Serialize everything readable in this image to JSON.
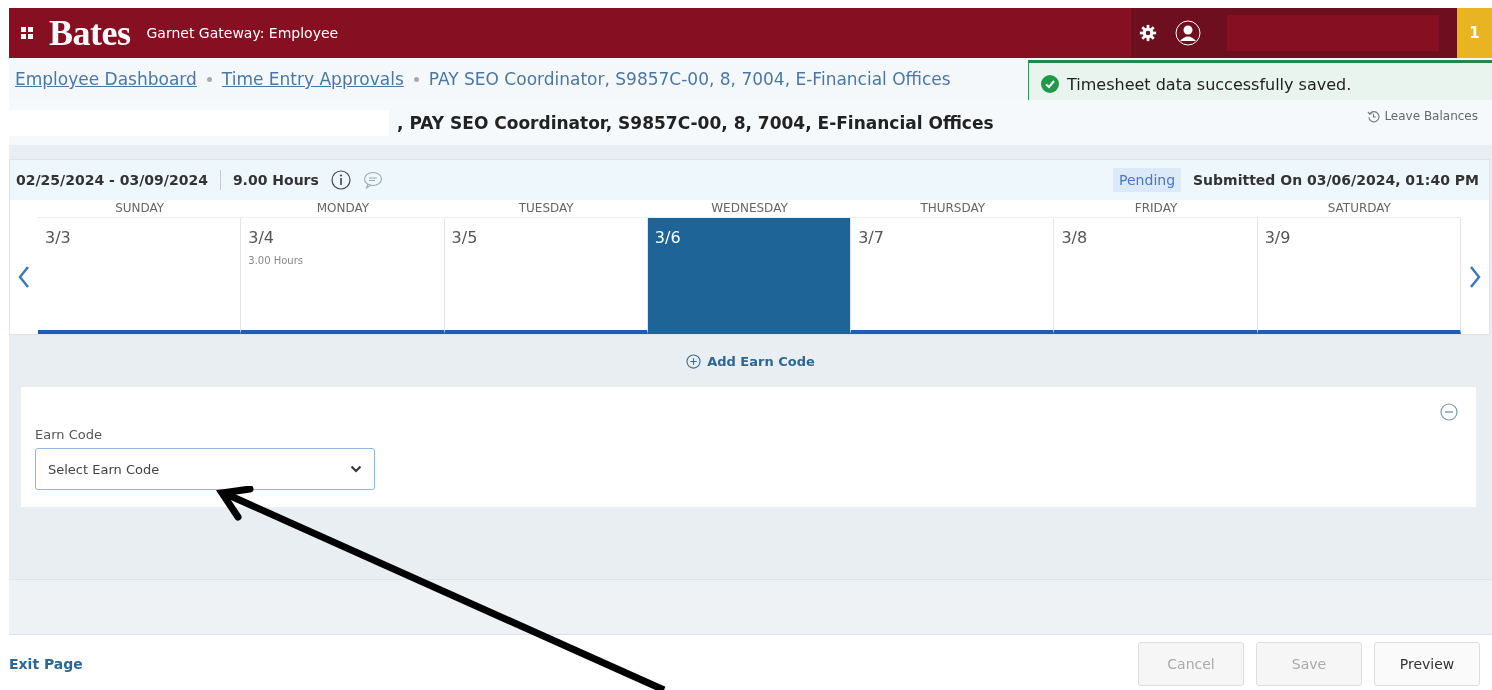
{
  "header": {
    "logo": "Bates",
    "app_title": "Garnet Gateway: Employee",
    "notification_count": "1"
  },
  "breadcrumbs": [
    {
      "label": "Employee Dashboard",
      "link": true
    },
    {
      "label": "Time Entry Approvals",
      "link": true
    },
    {
      "label": "PAY SEO Coordinator, S9857C-00, 8, 7004, E-Financial Offices",
      "link": false
    }
  ],
  "toast": {
    "message": "Timesheet data successfully saved."
  },
  "page_title": ", PAY SEO Coordinator, S9857C-00, 8, 7004, E-Financial Offices",
  "leave_balances": "Leave Balances",
  "timesheet": {
    "period": "02/25/2024 - 03/09/2024",
    "total": "9.00 Hours",
    "status": "Pending",
    "submitted": "Submitted On 03/06/2024, 01:40 PM",
    "days": [
      {
        "weekday": "SUNDAY",
        "date": "3/3",
        "selected": false
      },
      {
        "weekday": "MONDAY",
        "date": "3/4",
        "hours": "3.00 Hours",
        "selected": false
      },
      {
        "weekday": "TUESDAY",
        "date": "3/5",
        "selected": false
      },
      {
        "weekday": "WEDNESDAY",
        "date": "3/6",
        "selected": true
      },
      {
        "weekday": "THURSDAY",
        "date": "3/7",
        "selected": false
      },
      {
        "weekday": "FRIDAY",
        "date": "3/8",
        "selected": false
      },
      {
        "weekday": "SATURDAY",
        "date": "3/9",
        "selected": false
      }
    ]
  },
  "add_earn_code": "Add Earn Code",
  "earn_code": {
    "label": "Earn Code",
    "placeholder": "Select Earn Code"
  },
  "footer": {
    "exit": "Exit Page",
    "buttons": [
      {
        "label": "Cancel",
        "disabled": true
      },
      {
        "label": "Save",
        "disabled": true
      },
      {
        "label": "Preview",
        "disabled": false
      }
    ]
  }
}
